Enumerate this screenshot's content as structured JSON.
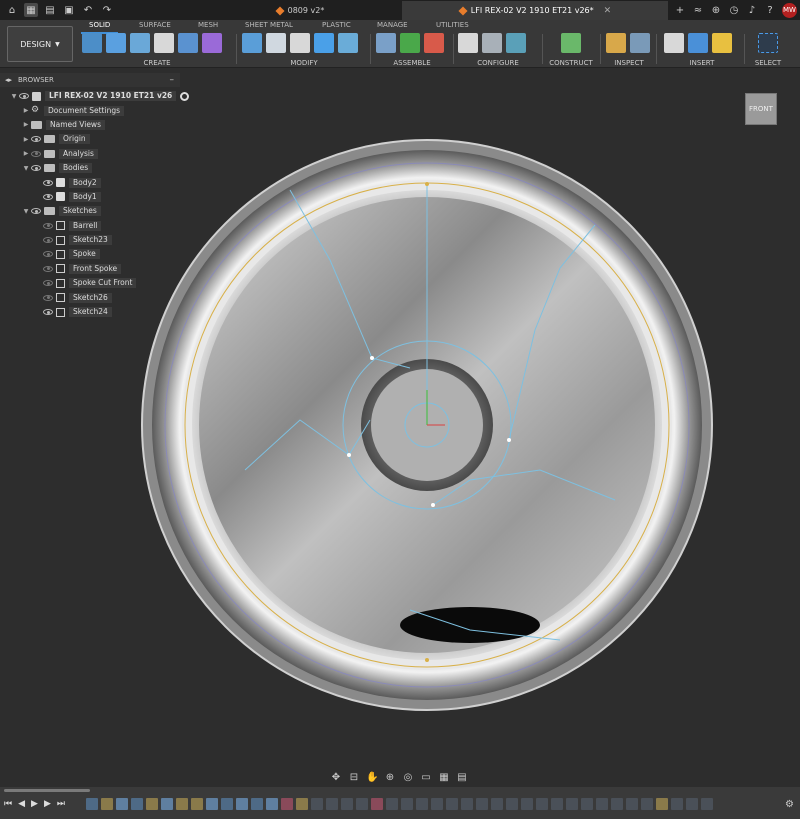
{
  "title_bar": {
    "tabs": [
      {
        "label": "0809 v2*",
        "active": false
      },
      {
        "label": "LFI REX-02 V2 1910 ET21 v26*",
        "active": true
      }
    ],
    "user_initials": "MW"
  },
  "ribbon": {
    "workspace_label": "DESIGN",
    "tabs": [
      "SOLID",
      "SURFACE",
      "MESH",
      "SHEET METAL",
      "PLASTIC",
      "MANAGE",
      "UTILITIES"
    ],
    "active_tab": "SOLID",
    "groups": [
      "CREATE",
      "MODIFY",
      "ASSEMBLE",
      "CONFIGURE",
      "CONSTRUCT",
      "INSPECT",
      "INSERT",
      "SELECT"
    ]
  },
  "browser": {
    "title": "BROWSER",
    "root": "LFI REX-02 V2 1910 ET21 v26",
    "items": [
      {
        "label": "Document Settings",
        "icon": "gear-icon",
        "expandable": true
      },
      {
        "label": "Named Views",
        "icon": "folder-icon",
        "expandable": true
      },
      {
        "label": "Origin",
        "icon": "folder-icon",
        "expandable": true,
        "visible": true
      },
      {
        "label": "Analysis",
        "icon": "folder-icon",
        "expandable": true,
        "visible": false
      },
      {
        "label": "Bodies",
        "icon": "folder-icon",
        "expandable": true,
        "expanded": true,
        "visible": true
      },
      {
        "label": "Body2",
        "icon": "body-icon",
        "child": true,
        "visible": true
      },
      {
        "label": "Body1",
        "icon": "body-icon",
        "child": true,
        "visible": true
      },
      {
        "label": "Sketches",
        "icon": "folder-icon",
        "expandable": true,
        "expanded": true,
        "visible": true
      },
      {
        "label": "Barrell",
        "icon": "sketch-icon",
        "child": true,
        "visible": false
      },
      {
        "label": "Sketch23",
        "icon": "sketch-icon",
        "child": true,
        "visible": false
      },
      {
        "label": "Spoke",
        "icon": "sketch-icon",
        "child": true,
        "visible": false
      },
      {
        "label": "Front Spoke",
        "icon": "sketch-icon",
        "child": true,
        "visible": false
      },
      {
        "label": "Spoke Cut Front",
        "icon": "sketch-icon",
        "child": true,
        "visible": false
      },
      {
        "label": "Sketch26",
        "icon": "sketch-icon",
        "child": true,
        "visible": false
      },
      {
        "label": "Sketch24",
        "icon": "sketch-icon",
        "child": true,
        "visible": true
      }
    ]
  },
  "viewcube": {
    "face": "FRONT"
  },
  "colors": {
    "accent": "#3f8fd8",
    "sketch_line": "#7ec0e0",
    "yellow_circle": "#d8b048",
    "background": "#2d2d2d"
  }
}
